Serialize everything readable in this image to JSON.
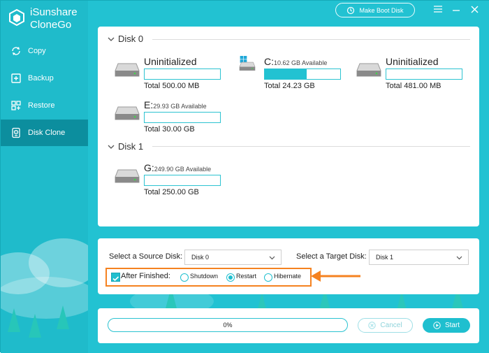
{
  "app": {
    "name_line1": "iSunshare",
    "name_line2": "CloneGo",
    "accent_color": "#1fbfcf",
    "highlight_color": "#f58220"
  },
  "sidebar": {
    "items": [
      {
        "label": "Copy",
        "icon": "copy-icon",
        "active": false
      },
      {
        "label": "Backup",
        "icon": "backup-icon",
        "active": false
      },
      {
        "label": "Restore",
        "icon": "restore-icon",
        "active": false
      },
      {
        "label": "Disk Clone",
        "icon": "disk-clone-icon",
        "active": true
      }
    ]
  },
  "titlebar": {
    "make_boot_disk_label": "Make Boot Disk",
    "menu_icon": "hamburger-menu-icon",
    "minimize_icon": "minimize-icon",
    "close_icon": "close-icon"
  },
  "disks": [
    {
      "label": "Disk 0",
      "partitions": [
        {
          "name": "Uninitialized",
          "available": "",
          "total": "Total 500.00 MB",
          "used_fraction": 0,
          "icon": "drive-icon"
        },
        {
          "name": "C:",
          "available": "10.62 GB Available",
          "total": "Total 24.23 GB",
          "used_fraction": 0.56,
          "icon": "windows-drive-icon"
        },
        {
          "name": "Uninitialized",
          "available": "",
          "total": "Total 481.00 MB",
          "used_fraction": 0,
          "icon": "drive-icon"
        },
        {
          "name": "E:",
          "available": "29.93 GB Available",
          "total": "Total 30.00 GB",
          "used_fraction": 0,
          "icon": "drive-icon"
        }
      ]
    },
    {
      "label": "Disk 1",
      "partitions": [
        {
          "name": "G:",
          "available": "249.90 GB Available",
          "total": "Total 250.00 GB",
          "used_fraction": 0,
          "icon": "drive-icon"
        }
      ]
    }
  ],
  "options": {
    "source_label": "Select a Source Disk:",
    "source_value": "Disk 0",
    "target_label": "Select a Target Disk:",
    "target_value": "Disk 1",
    "after_finished_label": "After Finished:",
    "after_finished_checked": true,
    "radio_options": [
      {
        "label": "Shutdown",
        "selected": false
      },
      {
        "label": "Restart",
        "selected": true
      },
      {
        "label": "Hibernate",
        "selected": false
      }
    ]
  },
  "bottom": {
    "progress_text": "0%",
    "progress_fraction": 0,
    "cancel_label": "Cancel",
    "start_label": "Start"
  }
}
